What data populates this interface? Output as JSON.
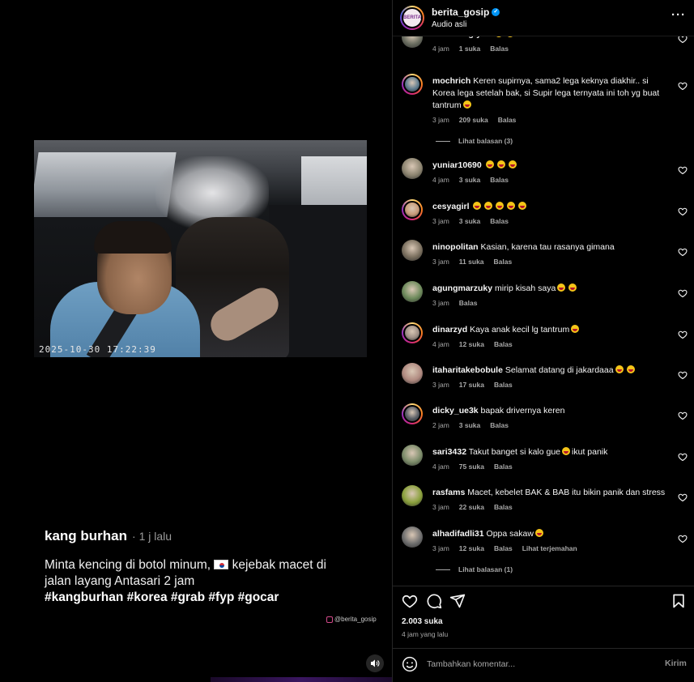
{
  "video": {
    "timestamp": "2025-10-30  17:22:39",
    "caption_author": "kang burhan",
    "caption_time": "· 1 j lalu",
    "caption_text_a": "Minta kencing di botol minum,",
    "caption_text_b": "kejebak macet di jalan layang Antasari 2 jam",
    "caption_tags": "#kangburhan #korea #grab #fyp #gocar",
    "watermark": "@berita_gosip",
    "sound_icon": "speaker-icon"
  },
  "header": {
    "username": "berita_gosip",
    "subtitle": "Audio asli",
    "avatar_text": "BERITA"
  },
  "comments": [
    {
      "user": "andiniringtyas",
      "text": "",
      "emojis": 2,
      "time": "4 jam",
      "likes": "1 suka",
      "reply": "Balas",
      "ring": false,
      "color": "#6a6d60"
    },
    {
      "user": "mochrich",
      "text": "Keren supirnya, sama2 lega keknya diakhir.. si Korea lega setelah bak, si Supir lega ternyata ini toh yg buat tantrum",
      "emojis": 1,
      "time": "3 jam",
      "likes": "209 suka",
      "reply": "Balas",
      "ring": true,
      "color": "#5f7c8f",
      "view_replies": "Lihat balasan (3)"
    },
    {
      "user": "yuniar10690",
      "text": "",
      "emojis": 3,
      "time": "4 jam",
      "likes": "3 suka",
      "reply": "Balas",
      "ring": false,
      "color": "#8c8470"
    },
    {
      "user": "cesyagirl",
      "text": "",
      "emojis": 5,
      "time": "3 jam",
      "likes": "3 suka",
      "reply": "Balas",
      "ring": true,
      "color": "#c79a78"
    },
    {
      "user": "ninopolitan",
      "text": "Kasian, karena tau rasanya gimana",
      "emojis": 0,
      "time": "3 jam",
      "likes": "11 suka",
      "reply": "Balas",
      "ring": false,
      "color": "#7a6f5e"
    },
    {
      "user": "agungmarzuky",
      "text": "mirip kisah saya",
      "emojis": 2,
      "time": "3 jam",
      "likes": "",
      "reply": "Balas",
      "ring": false,
      "color": "#6d8a5b"
    },
    {
      "user": "dinarzyd",
      "text": "Kaya anak kecil lg tantrum",
      "emojis": 1,
      "time": "4 jam",
      "likes": "12 suka",
      "reply": "Balas",
      "ring": true,
      "color": "#9f8f85"
    },
    {
      "user": "itaharitakebobule",
      "text": "Selamat datang di jakardaaa",
      "emojis": 2,
      "time": "3 jam",
      "likes": "17 suka",
      "reply": "Balas",
      "ring": false,
      "color": "#b08a80"
    },
    {
      "user": "dicky_ue3k",
      "text": "bapak drivernya keren",
      "emojis": 0,
      "time": "2 jam",
      "likes": "3 suka",
      "reply": "Balas",
      "ring": true,
      "color": "#5a5e66"
    },
    {
      "user": "sari3432",
      "text": "Takut banget si kalo gue",
      "text2": "ikut panik",
      "emojis": 0,
      "mid_emoji": true,
      "time": "4 jam",
      "likes": "75 suka",
      "reply": "Balas",
      "ring": false,
      "color": "#7c8c6a"
    },
    {
      "user": "rasfams",
      "text": "Macet, kebelet BAK & BAB itu bikin panik dan stress",
      "emojis": 0,
      "time": "3 jam",
      "likes": "22 suka",
      "reply": "Balas",
      "ring": false,
      "color": "#8aa03c"
    },
    {
      "user": "alhadifadli31",
      "text": "Oppa sakaw",
      "emojis": 1,
      "time": "3 jam",
      "likes": "12 suka",
      "reply": "Balas",
      "translate": "Lihat terjemahan",
      "ring": false,
      "color": "#6e6e6e",
      "view_replies": "Lihat balasan (1)"
    }
  ],
  "actions": {
    "likes": "2.003 suka",
    "posted": "4 jam yang lalu"
  },
  "compose": {
    "placeholder": "Tambahkan komentar...",
    "send": "Kirim"
  },
  "colors": {
    "background": "#000000",
    "text_primary": "#f5f5f5",
    "text_secondary": "#a8a8a8",
    "verified": "#0095f6",
    "divider": "#262626"
  }
}
